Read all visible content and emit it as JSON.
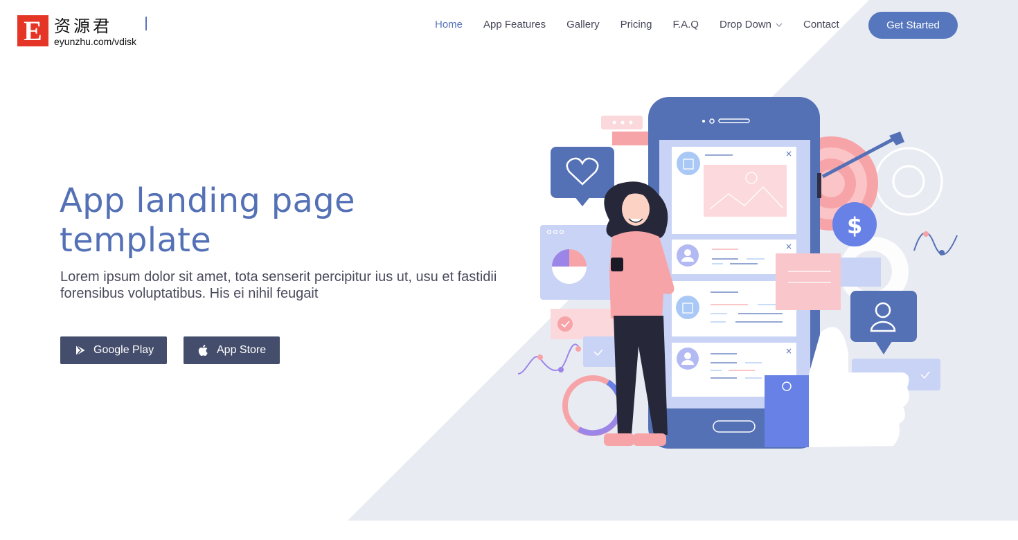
{
  "logo": {
    "mark": "E",
    "name_cn": "资源君",
    "url_text": "eyunzhu.com/vdisk"
  },
  "nav": {
    "items": [
      {
        "label": "Home",
        "active": true
      },
      {
        "label": "App Features"
      },
      {
        "label": "Gallery"
      },
      {
        "label": "Pricing"
      },
      {
        "label": "F.A.Q"
      },
      {
        "label": "Drop Down",
        "has_dropdown": true
      },
      {
        "label": "Contact"
      }
    ],
    "cta_label": "Get Started"
  },
  "hero": {
    "title": "App landing page template",
    "subtitle": "Lorem ipsum dolor sit amet, tota senserit percipitur ius ut, usu et fastidii forensibus voluptatibus. His ei nihil feugait",
    "buttons": [
      {
        "label": "Google Play",
        "icon": "google-play-icon"
      },
      {
        "label": "App Store",
        "icon": "apple-icon"
      }
    ]
  },
  "colors": {
    "accent": "#5677bd",
    "title": "#5571b6",
    "store_button": "#444e6c",
    "hero_bg": "#e8ebf2",
    "logo_red": "#e53526"
  },
  "illustration": {
    "description": "Woman holding a phone in front of a large smartphone with notification cards, heart bubble, target with arrow, dollar coin, gears, user bubble, thumbs-up"
  }
}
